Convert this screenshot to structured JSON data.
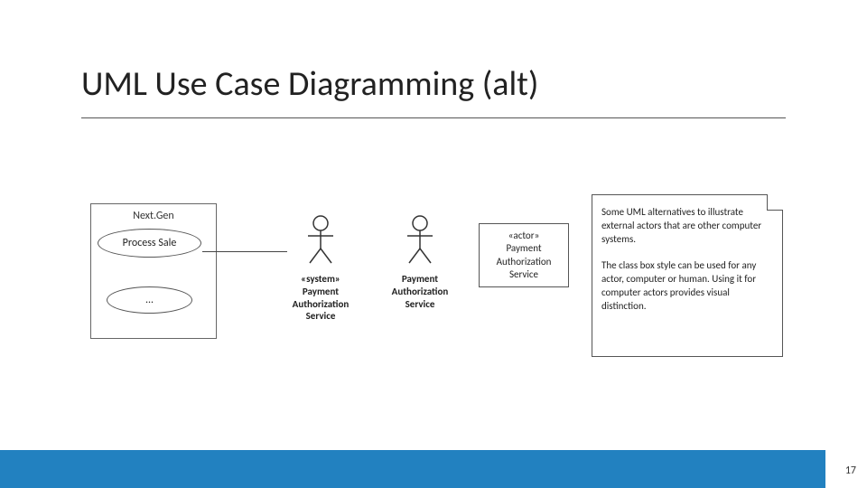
{
  "title": "UML Use Case Diagramming (alt)",
  "diagram": {
    "system_box_title": "Next.Gen",
    "usecase_1": "Process Sale",
    "usecase_2": "...",
    "actor1_stereotype": "«system»",
    "actor1_name": "Payment Authorization Service",
    "actor2_name": "Payment Authorization Service",
    "classbox_stereotype": "«actor»",
    "classbox_name": "Payment Authorization Service",
    "note_p1": "Some UML alternatives to illustrate external actors that are other computer systems.",
    "note_p2": "The class box style can be used for any actor, computer or human. Using it for computer actors provides visual distinction."
  },
  "page_number": "17"
}
